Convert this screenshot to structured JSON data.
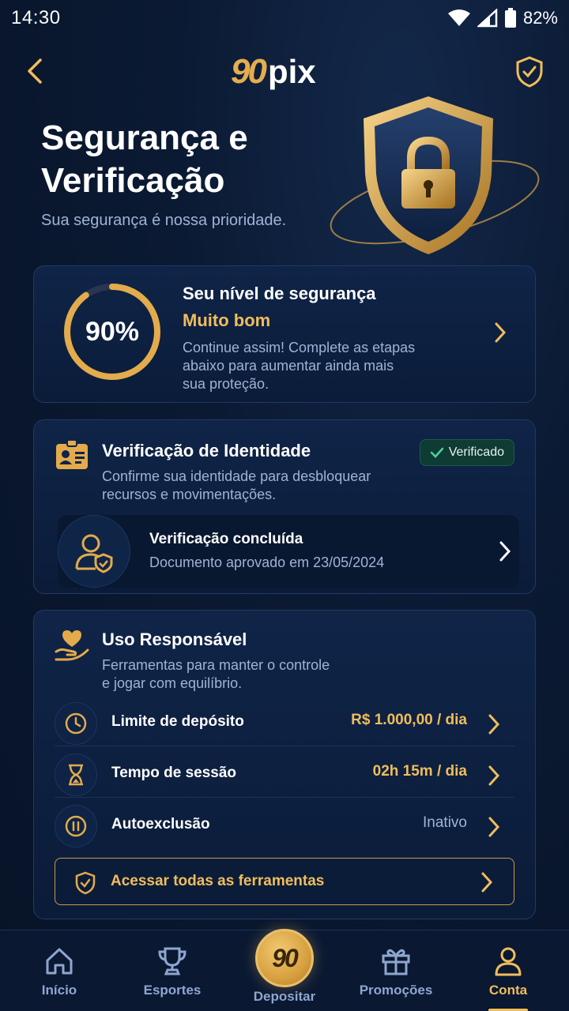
{
  "status_bar": {
    "time": "14:30",
    "battery": "82%"
  },
  "header": {
    "logo_number": "90",
    "logo_text": "pix"
  },
  "hero": {
    "title_line1": "Segurança e",
    "title_line2": "Verificação",
    "subtitle": "Sua segurança é nossa prioridade."
  },
  "security_score": {
    "percent_text": "90%",
    "progress": 0.9,
    "title": "Seu nível de segurança",
    "level": "Muito bom",
    "desc_line1": "Continue assim! Complete as etapas",
    "desc_line2": "abaixo para aumentar ainda mais",
    "desc_line3": "sua proteção."
  },
  "identity": {
    "title": "Verificação de Identidade",
    "desc_line1": "Confirme sua identidade para desbloquear",
    "desc_line2": "recursos e movimentações.",
    "badge": "Verificado",
    "status_title": "Verificação concluída",
    "status_sub": "Documento aprovado em 23/05/2024"
  },
  "responsible": {
    "title": "Uso Responsável",
    "desc_line1": "Ferramentas para manter o controle",
    "desc_line2": "e jogar com equilíbrio.",
    "rows": [
      {
        "label": "Limite de depósito",
        "value": "R$ 1.000,00 / dia",
        "icon": "clock-icon"
      },
      {
        "label": "Tempo de sessão",
        "value": "02h 15m / dia",
        "icon": "hourglass-icon"
      },
      {
        "label": "Autoexclusão",
        "value": "Inativo",
        "icon": "pause-icon"
      }
    ],
    "tools_button": "Acessar todas as ferramentas"
  },
  "bottom_nav": {
    "items": [
      {
        "label": "Início",
        "icon": "home-icon"
      },
      {
        "label": "Esportes",
        "icon": "trophy-icon"
      },
      {
        "label": "Depositar",
        "icon": "deposit-icon"
      },
      {
        "label": "Promoções",
        "icon": "gift-icon"
      },
      {
        "label": "Conta",
        "icon": "user-icon"
      }
    ],
    "active": "Conta",
    "deposit_badge": "90"
  },
  "colors": {
    "accent_gold": "#f0bd5c",
    "background": "#0b1a33",
    "verified_green": "#0f3b35"
  }
}
